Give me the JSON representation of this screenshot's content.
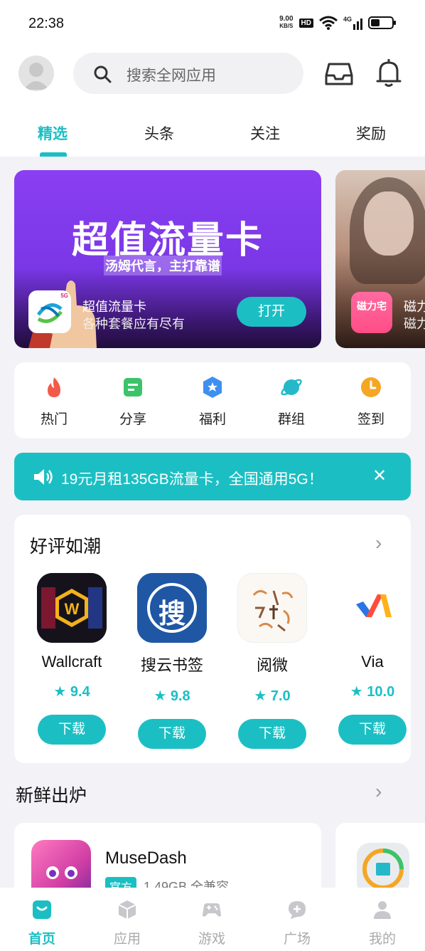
{
  "status_bar": {
    "time": "22:38",
    "net_speed_value": "9.00",
    "net_speed_unit": "KB/S",
    "hd": "HD",
    "signal": "4G"
  },
  "search": {
    "placeholder": "搜索全网应用"
  },
  "tabs": [
    {
      "label": "精选"
    },
    {
      "label": "头条"
    },
    {
      "label": "关注"
    },
    {
      "label": "奖励"
    }
  ],
  "banners": [
    {
      "headline": "超值流量卡",
      "subline": "汤姆代言，主打靠谱",
      "icon_badge": "5G",
      "title": "超值流量卡",
      "desc": "各种套餐应有尽有",
      "button": "打开"
    },
    {
      "icon_text": "磁力宅",
      "title": "磁力",
      "desc": "磁力"
    }
  ],
  "quick_nav": [
    {
      "label": "热门",
      "icon": "flame-icon",
      "color": "#f25a4a"
    },
    {
      "label": "分享",
      "icon": "share-doc-icon",
      "color": "#3cc36a"
    },
    {
      "label": "福利",
      "icon": "star-badge-icon",
      "color": "#3f8ff0"
    },
    {
      "label": "群组",
      "icon": "planet-icon",
      "color": "#25b8c9"
    },
    {
      "label": "签到",
      "icon": "clock-icon",
      "color": "#f5a623"
    }
  ],
  "notice": {
    "text": "19元月租135GB流量卡，全国通用5G！",
    "close": "✕"
  },
  "good_reviews": {
    "title": "好评如潮",
    "apps": [
      {
        "name": "Wallcraft",
        "rating": "9.4",
        "button": "下载"
      },
      {
        "name": "搜云书签",
        "rating": "9.8",
        "button": "下载",
        "icon_char": "搜"
      },
      {
        "name": "阅微",
        "rating": "7.0",
        "button": "下载"
      },
      {
        "name": "Via",
        "rating": "10.0",
        "button": "下载"
      }
    ]
  },
  "fresh": {
    "title": "新鲜出炉",
    "app": {
      "name": "MuseDash",
      "tag": "官方",
      "meta": "1.49GB 全兼容"
    }
  },
  "bottom_nav": [
    {
      "label": "首页",
      "icon": "home-bag-icon",
      "active": true
    },
    {
      "label": "应用",
      "icon": "cube-icon"
    },
    {
      "label": "游戏",
      "icon": "gamepad-icon"
    },
    {
      "label": "广场",
      "icon": "chat-plus-icon"
    },
    {
      "label": "我的",
      "icon": "person-icon"
    }
  ],
  "colors": {
    "accent": "#1bbfc3",
    "banner_purple": "#7a37e6"
  }
}
